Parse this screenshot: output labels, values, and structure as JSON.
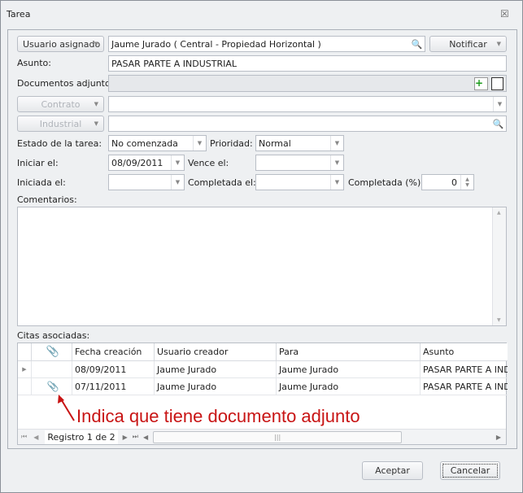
{
  "window": {
    "title": "Tarea",
    "close_icon": "close-icon"
  },
  "form": {
    "assigned_user_button": "Usuario asignado",
    "assigned_user_value": "Jaume Jurado ( Central - Propiedad Horizontal )",
    "notify_button": "Notificar",
    "subject_label": "Asunto:",
    "subject_value": "PASAR PARTE A INDUSTRIAL",
    "attachments_label": "Documentos adjuntos:",
    "attachments_value": "",
    "contract_button": "Contrato",
    "contract_value": "",
    "industrial_button": "Industrial",
    "industrial_value": "",
    "status_label": "Estado de la tarea:",
    "status_value": "No comenzada",
    "priority_label": "Prioridad:",
    "priority_value": "Normal",
    "start_label": "Iniciar el:",
    "start_value": "08/09/2011",
    "due_label": "Vence el:",
    "due_value": "",
    "started_label": "Iniciada el:",
    "started_value": "",
    "completed_label": "Completada el:",
    "completed_value": "",
    "percent_label": "Completada (%):",
    "percent_value": "0",
    "comments_label": "Comentarios:",
    "comments_value": ""
  },
  "grid": {
    "label": "Citas asociadas:",
    "columns": [
      "Fecha creación",
      "Usuario creador",
      "Para",
      "Asunto"
    ],
    "rows": [
      {
        "attachment": false,
        "fecha": "08/09/2011",
        "usuario": "Jaume Jurado",
        "para": "Jaume Jurado",
        "asunto": "PASAR PARTE A INDUSTRIAL"
      },
      {
        "attachment": true,
        "fecha": "07/11/2011",
        "usuario": "Jaume Jurado",
        "para": "Jaume Jurado",
        "asunto": "PASAR PARTE A INDUSTRIAL"
      }
    ],
    "navigator": "Registro 1 de 2"
  },
  "annotation": {
    "text": "Indica que tiene documento adjunto",
    "color": "#c81414"
  },
  "footer": {
    "accept": "Aceptar",
    "cancel": "Cancelar"
  }
}
